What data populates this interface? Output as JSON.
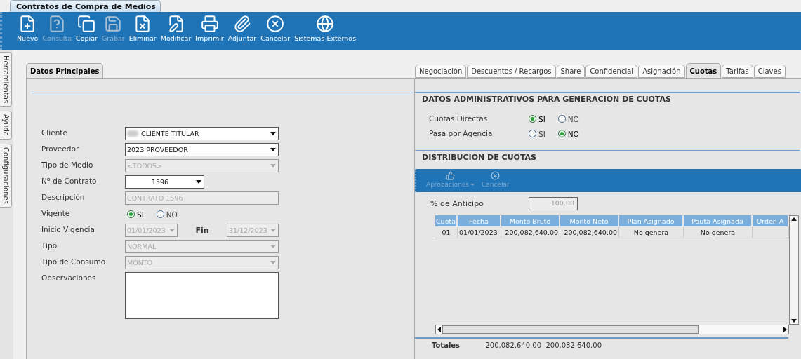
{
  "window_tab": {
    "title": "Contratos de Compra de Medios"
  },
  "toolbar": [
    {
      "label": "Nuevo",
      "disabled": false
    },
    {
      "label": "Consulta",
      "disabled": true
    },
    {
      "label": "Copiar",
      "disabled": false
    },
    {
      "label": "Grabar",
      "disabled": true
    },
    {
      "label": "Eliminar",
      "disabled": false
    },
    {
      "label": "Modificar",
      "disabled": false
    },
    {
      "label": "Imprimir",
      "disabled": false
    },
    {
      "label": "Adjuntar",
      "disabled": false
    },
    {
      "label": "Cancelar",
      "disabled": false
    },
    {
      "label": "Sistemas Externos",
      "disabled": false
    }
  ],
  "side_tabs": [
    "Herramientas",
    "Ayuda",
    "Configuraciones"
  ],
  "left_tabs": [
    {
      "label": "Datos Principales",
      "selected": true
    }
  ],
  "form": [
    {
      "kind": "select",
      "label": "Cliente",
      "value": "CLIENTE TITULAR",
      "disabled": false,
      "redacted": true
    },
    {
      "kind": "select",
      "label": "Proveedor",
      "value": "2023 PROVEEDOR",
      "disabled": false
    },
    {
      "kind": "select",
      "label": "Tipo de Medio",
      "value": "<TODOS>",
      "disabled": true
    },
    {
      "kind": "combo",
      "label": "Nº de Contrato",
      "value": "1596"
    },
    {
      "kind": "text",
      "label": "Descripción",
      "value": "CONTRATO 1596",
      "disabled": true
    },
    {
      "kind": "radio",
      "label": "Vigente",
      "options": [
        {
          "label": "SI",
          "selected": true
        },
        {
          "label": "NO",
          "selected": false
        }
      ]
    },
    {
      "kind": "daterange",
      "label": "Inicio Vigencia",
      "value": "01/01/2023",
      "end_label": "Fin",
      "end_value": "31/12/2023",
      "disabled": true
    },
    {
      "kind": "select",
      "label": "Tipo",
      "value": "NORMAL",
      "disabled": true
    },
    {
      "kind": "select",
      "label": "Tipo de Consumo",
      "value": "MONTO",
      "disabled": true
    },
    {
      "kind": "textarea",
      "label": "Observaciones"
    }
  ],
  "right_tabs": [
    {
      "label": "Negociación",
      "selected": false
    },
    {
      "label": "Descuentos / Recargos",
      "selected": false
    },
    {
      "label": "Share",
      "selected": false
    },
    {
      "label": "Confidencial",
      "selected": false
    },
    {
      "label": "Asignación",
      "selected": false
    },
    {
      "label": "Cuotas",
      "selected": true
    },
    {
      "label": "Tarifas",
      "selected": false
    },
    {
      "label": "Claves",
      "selected": false
    }
  ],
  "admin_section": {
    "title": "DATOS ADMINISTRATIVOS PARA GENERACION DE CUOTAS",
    "rows": [
      {
        "label": "Cuotas Directas",
        "options": [
          {
            "label": "SI",
            "selected": true
          },
          {
            "label": "NO",
            "selected": false
          }
        ]
      },
      {
        "label": "Pasa por Agencia",
        "options": [
          {
            "label": "SI",
            "selected": false
          },
          {
            "label": "NO",
            "selected": true
          }
        ]
      }
    ]
  },
  "distribution": {
    "title": "DISTRIBUCION DE CUOTAS",
    "toolbar": [
      {
        "label": "Aprobaciones",
        "dropdown": true,
        "disabled": true
      },
      {
        "label": "Cancelar",
        "dropdown": false,
        "disabled": true
      }
    ],
    "anticipo": {
      "label": "% de Anticipo",
      "value": "100.00"
    },
    "table": {
      "columns": [
        "Cuota",
        "Fecha",
        "Monto Bruto",
        "Monto Neto",
        "Plan Asignado",
        "Pauta Asignada",
        "Orden A"
      ],
      "rows": [
        [
          "01",
          "01/01/2023",
          "200,082,640.00",
          "200,082,640.00",
          "No genera",
          "No genera",
          ""
        ]
      ]
    },
    "totals": {
      "label": "Totales",
      "values": [
        "200,082,640.00",
        "200,082,640.00"
      ]
    }
  }
}
